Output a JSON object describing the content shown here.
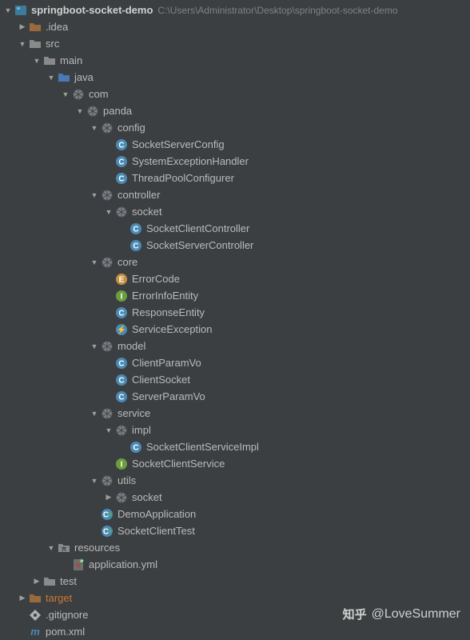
{
  "project": {
    "name": "springboot-socket-demo",
    "path": "C:\\Users\\Administrator\\Desktop\\springboot-socket-demo"
  },
  "tree": [
    {
      "indent": 0,
      "arrow": "down",
      "icon": "module",
      "label": "springboot-socket-demo",
      "bold": true,
      "note_key": "project.path"
    },
    {
      "indent": 1,
      "arrow": "right",
      "icon": "folder-ex",
      "label": ".idea"
    },
    {
      "indent": 1,
      "arrow": "down",
      "icon": "folder",
      "label": "src"
    },
    {
      "indent": 2,
      "arrow": "down",
      "icon": "folder",
      "label": "main"
    },
    {
      "indent": 3,
      "arrow": "down",
      "icon": "source",
      "label": "java"
    },
    {
      "indent": 4,
      "arrow": "down",
      "icon": "package",
      "label": "com"
    },
    {
      "indent": 5,
      "arrow": "down",
      "icon": "package",
      "label": "panda"
    },
    {
      "indent": 6,
      "arrow": "down",
      "icon": "package",
      "label": "config"
    },
    {
      "indent": 7,
      "arrow": "",
      "icon": "class",
      "label": "SocketServerConfig"
    },
    {
      "indent": 7,
      "arrow": "",
      "icon": "class",
      "label": "SystemExceptionHandler"
    },
    {
      "indent": 7,
      "arrow": "",
      "icon": "class",
      "label": "ThreadPoolConfigurer"
    },
    {
      "indent": 6,
      "arrow": "down",
      "icon": "package",
      "label": "controller"
    },
    {
      "indent": 7,
      "arrow": "down",
      "icon": "package",
      "label": "socket"
    },
    {
      "indent": 8,
      "arrow": "",
      "icon": "class",
      "label": "SocketClientController"
    },
    {
      "indent": 8,
      "arrow": "",
      "icon": "class",
      "label": "SocketServerController"
    },
    {
      "indent": 6,
      "arrow": "down",
      "icon": "package",
      "label": "core"
    },
    {
      "indent": 7,
      "arrow": "",
      "icon": "enum",
      "label": "ErrorCode"
    },
    {
      "indent": 7,
      "arrow": "",
      "icon": "interface",
      "label": "ErrorInfoEntity"
    },
    {
      "indent": 7,
      "arrow": "",
      "icon": "class",
      "label": "ResponseEntity"
    },
    {
      "indent": 7,
      "arrow": "",
      "icon": "exception",
      "label": "ServiceException"
    },
    {
      "indent": 6,
      "arrow": "down",
      "icon": "package",
      "label": "model"
    },
    {
      "indent": 7,
      "arrow": "",
      "icon": "class",
      "label": "ClientParamVo"
    },
    {
      "indent": 7,
      "arrow": "",
      "icon": "class",
      "label": "ClientSocket"
    },
    {
      "indent": 7,
      "arrow": "",
      "icon": "class",
      "label": "ServerParamVo"
    },
    {
      "indent": 6,
      "arrow": "down",
      "icon": "package",
      "label": "service"
    },
    {
      "indent": 7,
      "arrow": "down",
      "icon": "package",
      "label": "impl"
    },
    {
      "indent": 8,
      "arrow": "",
      "icon": "class",
      "label": "SocketClientServiceImpl"
    },
    {
      "indent": 7,
      "arrow": "",
      "icon": "interface",
      "label": "SocketClientService"
    },
    {
      "indent": 6,
      "arrow": "down",
      "icon": "package",
      "label": "utils"
    },
    {
      "indent": 7,
      "arrow": "right",
      "icon": "package",
      "label": "socket"
    },
    {
      "indent": 6,
      "arrow": "",
      "icon": "class-run",
      "label": "DemoApplication"
    },
    {
      "indent": 6,
      "arrow": "",
      "icon": "class-run",
      "label": "SocketClientTest"
    },
    {
      "indent": 3,
      "arrow": "down",
      "icon": "resources",
      "label": "resources"
    },
    {
      "indent": 4,
      "arrow": "",
      "icon": "yaml",
      "label": "application.yml"
    },
    {
      "indent": 2,
      "arrow": "right",
      "icon": "folder",
      "label": "test"
    },
    {
      "indent": 1,
      "arrow": "right",
      "icon": "folder-ex",
      "label": "target",
      "orange": true
    },
    {
      "indent": 1,
      "arrow": "",
      "icon": "gitignore",
      "label": ".gitignore"
    },
    {
      "indent": 1,
      "arrow": "",
      "icon": "maven",
      "label": "pom.xml"
    }
  ],
  "watermark": {
    "brand": "知乎",
    "handle": "@LoveSummer"
  }
}
